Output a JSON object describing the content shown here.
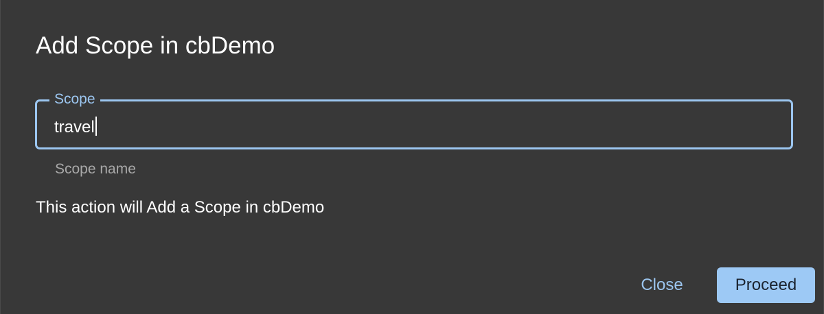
{
  "dialog": {
    "title": "Add Scope in cbDemo",
    "field": {
      "label": "Scope",
      "value": "travel",
      "helper": "Scope name"
    },
    "message": "This action will Add a Scope in cbDemo",
    "buttons": {
      "close_label": "Close",
      "proceed_label": "Proceed"
    }
  },
  "colors": {
    "dialog_background": "#383838",
    "accent": "#9cc6f0",
    "primary_button": "#9dc9f5",
    "helper_text": "#a9a9a9"
  }
}
